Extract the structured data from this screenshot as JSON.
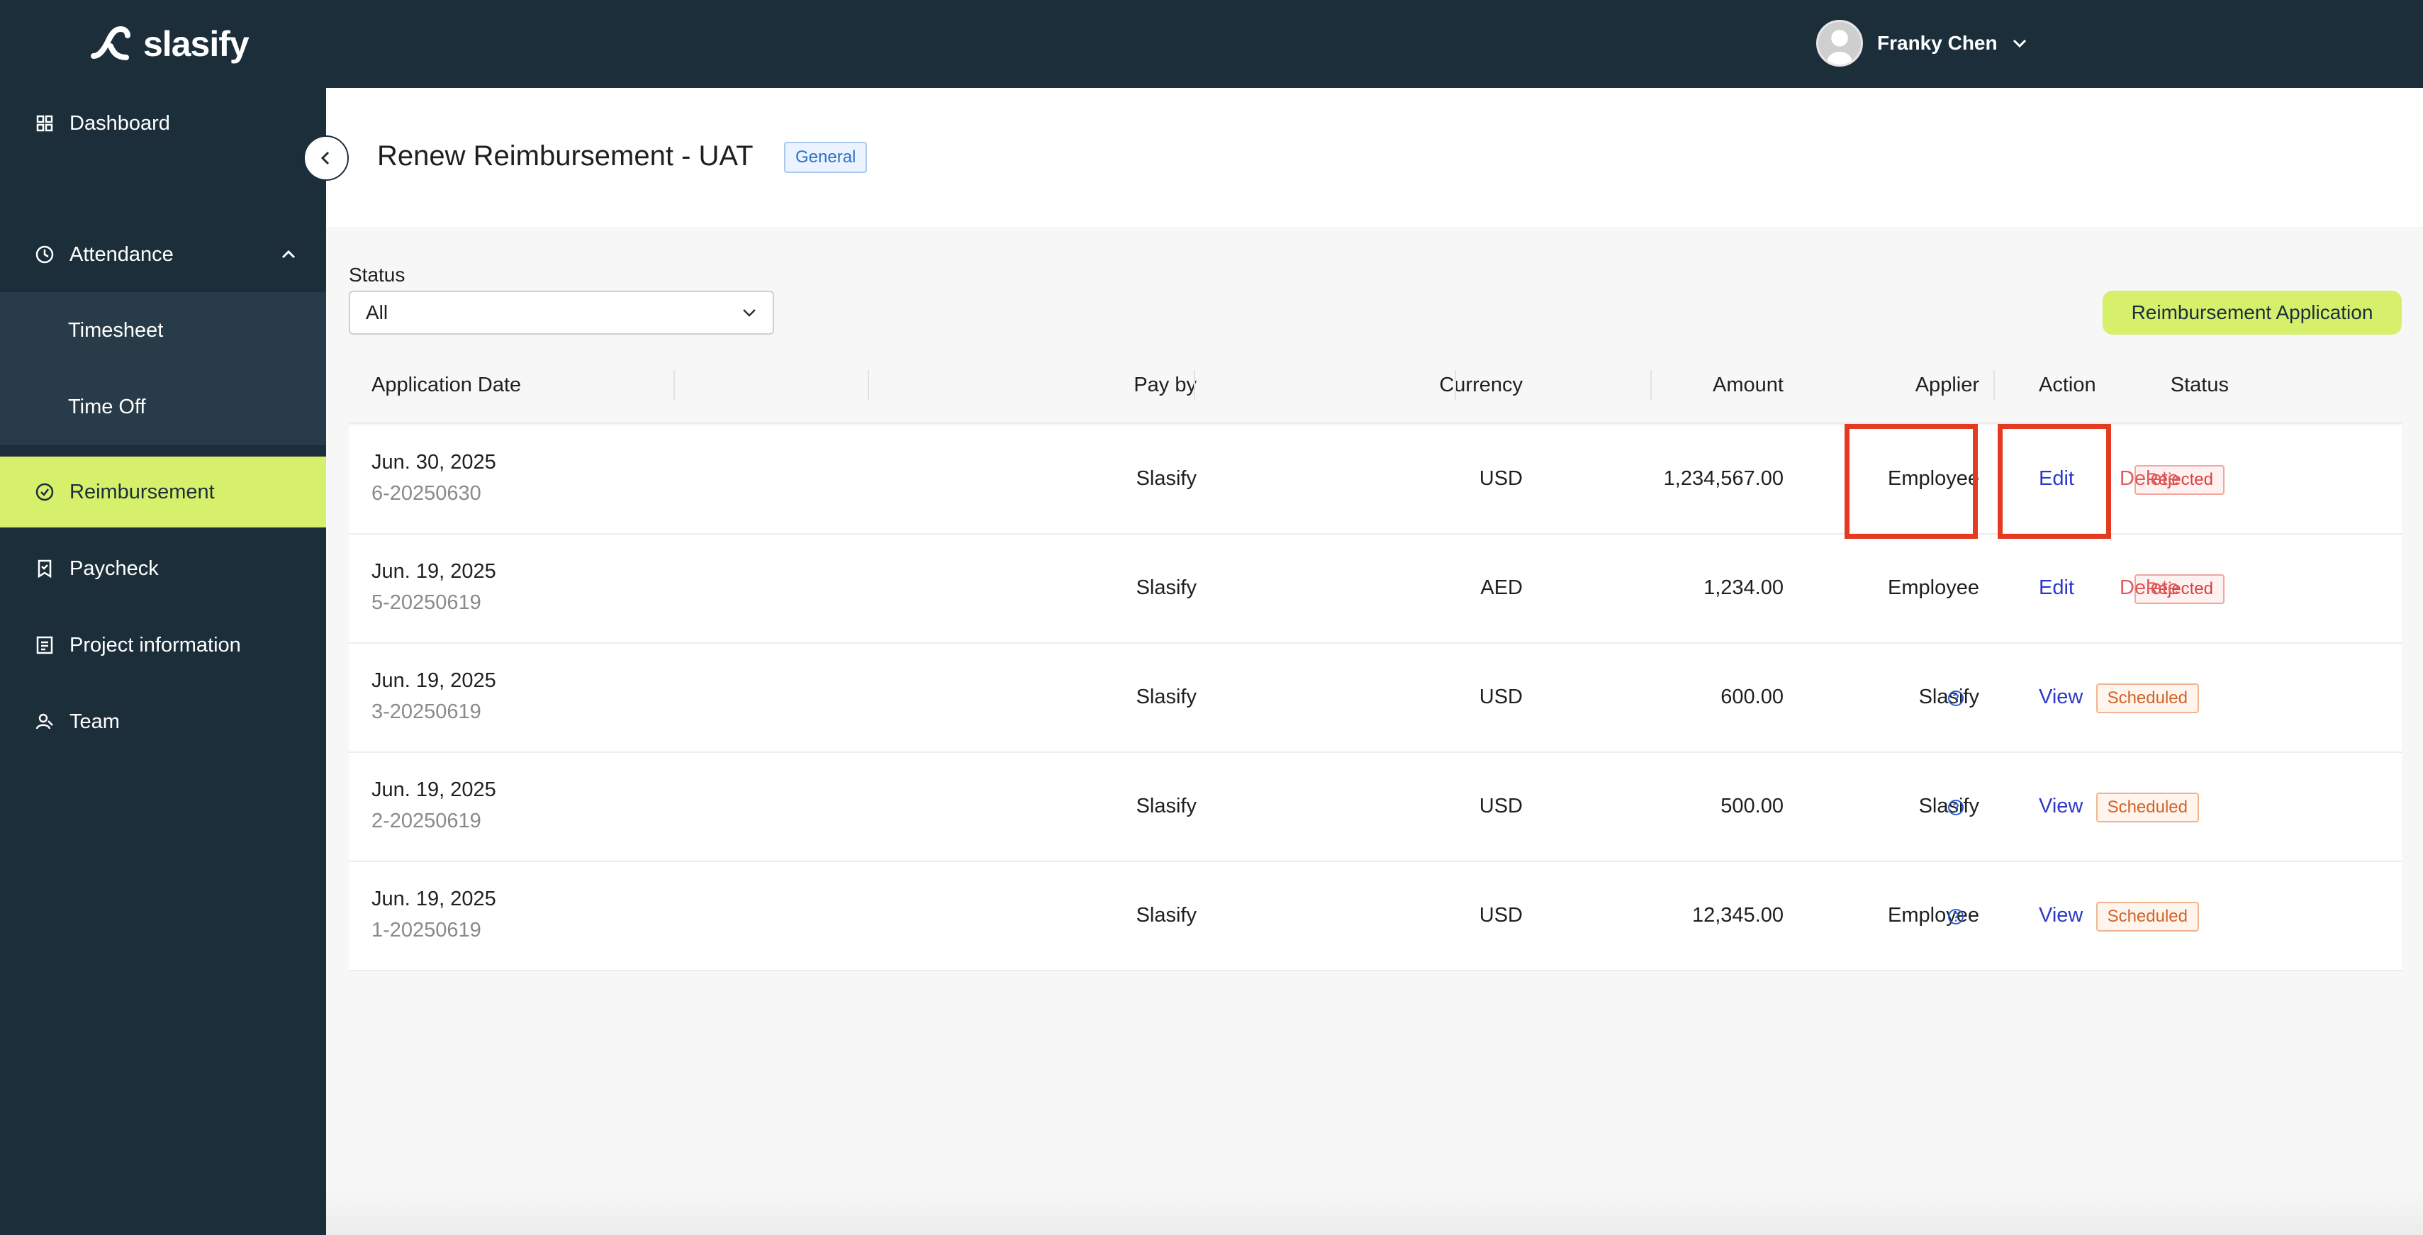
{
  "brand": {
    "name": "slasify"
  },
  "user": {
    "name": "Franky Chen"
  },
  "sidebar": {
    "items": [
      {
        "label": "Dashboard",
        "icon": "grid-icon"
      },
      {
        "label": "Attendance",
        "icon": "clock-icon"
      },
      {
        "label": "Timesheet"
      },
      {
        "label": "Time Off"
      },
      {
        "label": "Reimbursement",
        "icon": "reimbursement-icon"
      },
      {
        "label": "Paycheck",
        "icon": "paycheck-icon"
      },
      {
        "label": "Project information",
        "icon": "document-list-icon"
      },
      {
        "label": "Team",
        "icon": "team-icon"
      }
    ]
  },
  "header": {
    "title": "Renew Reimbursement - UAT",
    "tag": "General"
  },
  "filter": {
    "label": "Status",
    "value": "All"
  },
  "toolbar": {
    "apply_label": "Reimbursement Application"
  },
  "table": {
    "columns": [
      "Application Date",
      "Pay by",
      "Currency",
      "Amount",
      "Applier",
      "Status",
      "Action"
    ],
    "rows": [
      {
        "date": "Jun. 30, 2025",
        "id": "6-20250630",
        "pay_by": "Slasify",
        "currency": "USD",
        "amount": "1,234,567.00",
        "applier": "Employee",
        "status": "Rejected",
        "actions": [
          "Edit",
          "Delete"
        ]
      },
      {
        "date": "Jun. 19, 2025",
        "id": "5-20250619",
        "pay_by": "Slasify",
        "currency": "AED",
        "amount": "1,234.00",
        "applier": "Employee",
        "status": "Rejected",
        "actions": [
          "Edit",
          "Delete"
        ]
      },
      {
        "date": "Jun. 19, 2025",
        "id": "3-20250619",
        "pay_by": "Slasify",
        "currency": "USD",
        "amount": "600.00",
        "applier": "Slasify",
        "status": "Scheduled",
        "actions": [
          "View"
        ]
      },
      {
        "date": "Jun. 19, 2025",
        "id": "2-20250619",
        "pay_by": "Slasify",
        "currency": "USD",
        "amount": "500.00",
        "applier": "Slasify",
        "status": "Scheduled",
        "actions": [
          "View"
        ]
      },
      {
        "date": "Jun. 19, 2025",
        "id": "1-20250619",
        "pay_by": "Slasify",
        "currency": "USD",
        "amount": "12,345.00",
        "applier": "Employee",
        "status": "Scheduled",
        "actions": [
          "View"
        ]
      }
    ]
  },
  "colors": {
    "nav_bg": "#1b2e3a",
    "accent": "#d7f06b",
    "rejected": "#d93f3f",
    "scheduled": "#d2622a",
    "link": "#2b38c9",
    "highlight": "#e53a22"
  }
}
